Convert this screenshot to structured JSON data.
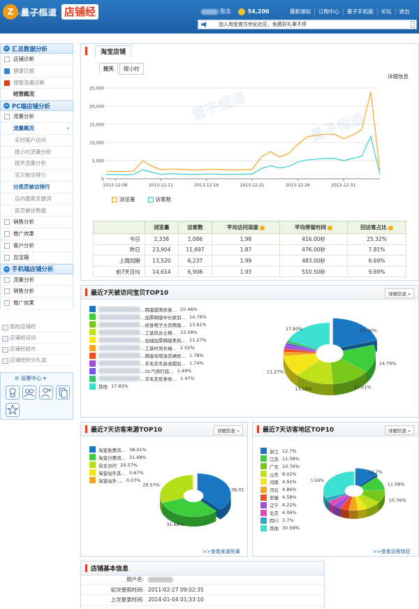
{
  "header": {
    "logo_mark": "Z",
    "logo_name": "量子恒道",
    "logo_sub": "DATA·UNIT 量化网店",
    "shop_badge": "店铺经",
    "user_suffix": ":思念",
    "coins": "54,200",
    "nav": [
      "最新通知",
      "订购中心",
      "量子手机版",
      "论坛",
      "退出"
    ],
    "notice": "加入淘宝官方优化社区，免费好礼拿不停"
  },
  "sidebar": {
    "sections": [
      {
        "title": "汇总数据分析",
        "items": [
          {
            "label": "店铺诊断",
            "style": "normal",
            "icon": "plain"
          },
          {
            "label": "健康日报",
            "style": "dim",
            "icon": "blue"
          },
          {
            "label": "搜索流量诊断",
            "style": "dim",
            "icon": "red"
          },
          {
            "label": "经营概况",
            "style": "bold",
            "icon": "none"
          }
        ]
      },
      {
        "title": "PC端店铺分析",
        "items": [
          {
            "label": "流量分析",
            "style": "normal",
            "icon": "plain"
          },
          {
            "label": "流量概况",
            "style": "cur",
            "icon": "none"
          },
          {
            "label": "实时客户访问",
            "style": "sub",
            "icon": "none"
          },
          {
            "label": "按小时流量分析",
            "style": "sub",
            "icon": "none"
          },
          {
            "label": "按天流量分析",
            "style": "sub",
            "icon": "none"
          },
          {
            "label": "宝贝被访排行",
            "style": "sub",
            "icon": "none"
          },
          {
            "label": "分类页被访排行",
            "style": "cur",
            "icon": "none"
          },
          {
            "label": "店内搜索关键词",
            "style": "sub",
            "icon": "none"
          },
          {
            "label": "首页被访数据",
            "style": "sub",
            "icon": "none"
          },
          {
            "label": "销售分析",
            "style": "normal",
            "icon": "plain"
          },
          {
            "label": "推广效果",
            "style": "normal",
            "icon": "plain"
          },
          {
            "label": "客户分析",
            "style": "normal",
            "icon": "plain"
          },
          {
            "label": "百宝箱",
            "style": "normal",
            "icon": "plain"
          }
        ]
      },
      {
        "title": "手机端店铺分析",
        "items": [
          {
            "label": "流量分析",
            "style": "normal",
            "icon": "plain"
          },
          {
            "label": "销售分析",
            "style": "normal",
            "icon": "plain"
          },
          {
            "label": "推广效果",
            "style": "normal",
            "icon": "plain"
          }
        ]
      }
    ],
    "tools": [
      "我的店铺经",
      "店铺经培训",
      "店铺经超市",
      "店铺经积分礼盒"
    ],
    "settings_label": "设置中心"
  },
  "traffic": {
    "tab": "淘宝店铺",
    "subtabs": [
      "按天",
      "按小时"
    ],
    "detail": "详细信息",
    "legend": [
      "浏览量",
      "访客数"
    ],
    "table": {
      "headers": [
        "",
        "浏览量",
        "访客数",
        "平均访问深度",
        "平均停留时间",
        "回访客占比"
      ],
      "rows": [
        [
          "今日",
          "2,338",
          "1,086",
          "1.98",
          "416.00秒",
          "25.32%"
        ],
        [
          "昨日",
          "23,904",
          "11,697",
          "1.87",
          "476.00秒",
          "7.81%"
        ],
        [
          "上周同期",
          "13,520",
          "6,237",
          "1.99",
          "483.00秒",
          "6.69%"
        ],
        [
          "前7天日均",
          "14,614",
          "6,906",
          "1.93",
          "510.50秒",
          "9.69%"
        ]
      ]
    }
  },
  "chart_data": [
    {
      "type": "line",
      "x": [
        "2013-12-05",
        "2013-12-06",
        "2013-12-07",
        "2013-12-08",
        "2013-12-09",
        "2013-12-10",
        "2013-12-11",
        "2013-12-12",
        "2013-12-13",
        "2013-12-14",
        "2013-12-15",
        "2013-12-16",
        "2013-12-17",
        "2013-12-18",
        "2013-12-19",
        "2013-12-20",
        "2013-12-21",
        "2013-12-22",
        "2013-12-23",
        "2013-12-24",
        "2013-12-25",
        "2013-12-26",
        "2013-12-27",
        "2013-12-28",
        "2013-12-29",
        "2013-12-30",
        "2013-12-31",
        "2014-01-01",
        "2014-01-02",
        "2014-01-03",
        "2014-01-04"
      ],
      "xticks": [
        "2013-12-06",
        "2013-12-11",
        "2013-12-16",
        "2013-12-21",
        "2013-12-26",
        "2013-12-31"
      ],
      "yticks": [
        "0",
        "5,000",
        "10,000",
        "15,000",
        "20,000",
        "25,000"
      ],
      "ylim": [
        0,
        25000
      ],
      "series": [
        {
          "name": "浏览量",
          "color": "#f5a623",
          "values": [
            2100,
            2000,
            2000,
            2100,
            5000,
            3500,
            2500,
            2700,
            2600,
            2500,
            2400,
            2600,
            2600,
            2500,
            2400,
            2500,
            2600,
            6000,
            7500,
            6000,
            7000,
            9500,
            11500,
            12000,
            12300,
            12300,
            11000,
            12000,
            13500,
            23900,
            2300
          ]
        },
        {
          "name": "访客数",
          "color": "#3ccccc",
          "values": [
            1200,
            1200,
            1100,
            1200,
            2500,
            1800,
            1200,
            1400,
            1300,
            1200,
            1200,
            1300,
            1300,
            1200,
            1200,
            1300,
            1300,
            2800,
            3600,
            3000,
            3400,
            4600,
            5200,
            5400,
            5600,
            5600,
            5000,
            5600,
            6200,
            11700,
            1100
          ]
        }
      ]
    },
    {
      "type": "pie",
      "title": "最近7天被访问宝贝TOP10",
      "labels": [
        "…韩版甜美修身…",
        "…加厚韩版中长款羽…",
        "…修身呢子大衣韩版…",
        "…工装风女士棉…",
        "…加绒加厚韩版美风…",
        "…工装时尚长袖…",
        "…韩版毛呢连衣裙修…",
        "…羊毛衣冬装连帽加…",
        "…OL气质打底…",
        "…羊毛衣反季修…",
        "其他"
      ],
      "values": [
        20.46,
        14.76,
        13.61,
        13.58,
        11.27,
        2.02,
        1.78,
        1.74,
        1.49,
        1.47,
        17.83
      ],
      "colors": [
        "#1a78c2",
        "#3dcd3d",
        "#76c81b",
        "#bfe01a",
        "#f5e61c",
        "#f2a71e",
        "#f04f24",
        "#a24fd8",
        "#7a53e0",
        "#3dbf6b",
        "#3be0d1"
      ]
    },
    {
      "type": "pie",
      "title": "最近7天访客来源TOP10",
      "labels": [
        "淘宝免费流…",
        "淘宝付费流…",
        "自主访问",
        "淘宝站外其…",
        "淘宝站外-…"
      ],
      "values": [
        38.01,
        31.68,
        29.57,
        0.67,
        0.07
      ],
      "colors": [
        "#1a78c2",
        "#3dcd3d",
        "#b4de1a",
        "#f5e61c",
        "#f2a71e"
      ]
    },
    {
      "type": "pie",
      "title": "最近7天访客地区TOP10",
      "labels": [
        "浙江",
        "江苏",
        "广东",
        "山东",
        "河南",
        "河北",
        "安徽",
        "辽宁",
        "北京",
        "四川",
        "其他"
      ],
      "values": [
        12.7,
        11.58,
        10.76,
        8.02,
        4.91,
        4.86,
        4.58,
        4.22,
        4.06,
        3.7,
        30.59
      ],
      "colors": [
        "#1a78c2",
        "#3dcd3d",
        "#76c81b",
        "#bfe01a",
        "#f5e61c",
        "#f2a71e",
        "#f04f24",
        "#a24fd8",
        "#e04ab8",
        "#2fa8c8",
        "#3be0d1"
      ]
    }
  ],
  "top_items": {
    "title": "最近7天被访问宝贝TOP10",
    "detail": "详细信息"
  },
  "sources": {
    "title": "最近7天访客来源TOP10",
    "detail": "详细信息",
    "more": ">>查看来源效果"
  },
  "regions": {
    "title": "最近7天访客地区TOP10",
    "detail": "详细信息",
    "more": ">>查看访客特征"
  },
  "basic_info": {
    "title": "店铺基本信息",
    "rows": [
      {
        "key": "用户名:",
        "value": ""
      },
      {
        "key": "初次使用时间:",
        "value": "2011-02-27 09:02:35"
      },
      {
        "key": "上次登录时间:",
        "value": "2014-01-04 01:33:10"
      }
    ]
  }
}
